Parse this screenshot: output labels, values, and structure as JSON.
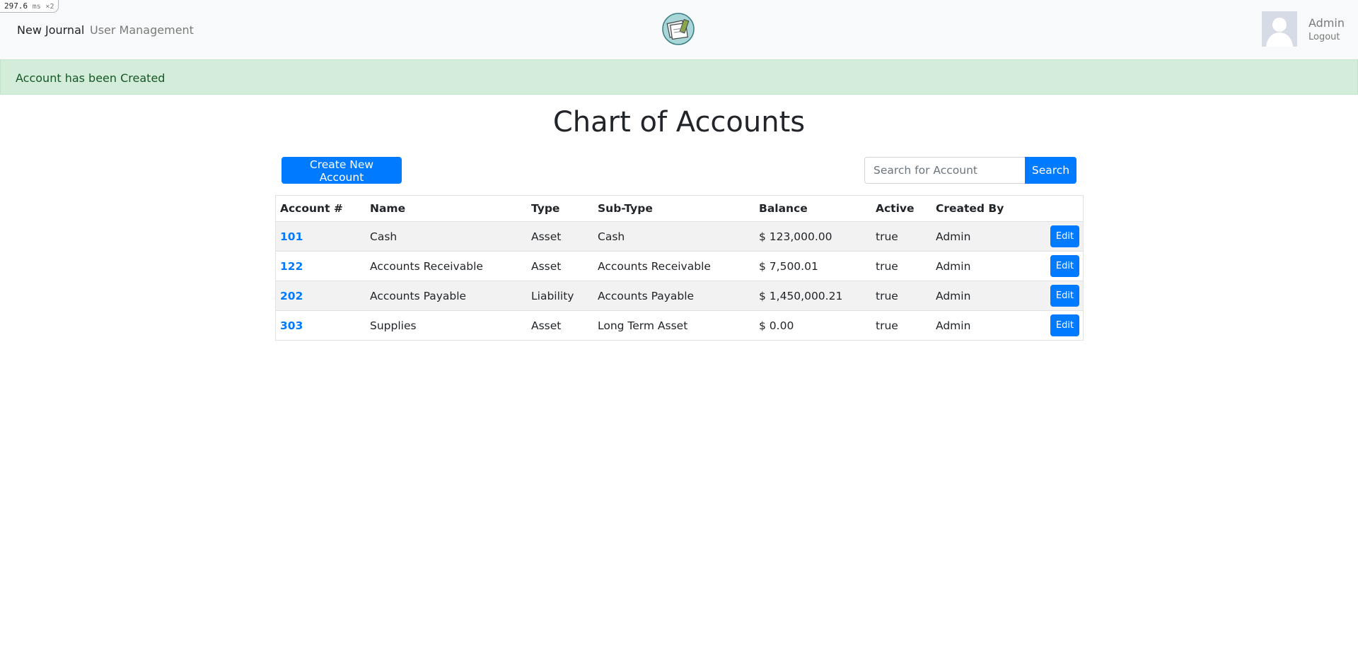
{
  "perf": {
    "value": "297.6",
    "unit": "ms",
    "mult": "×2"
  },
  "nav": {
    "links": [
      {
        "label": "New Journal"
      },
      {
        "label": "User Management"
      }
    ],
    "user": {
      "name": "Admin",
      "logout": "Logout"
    }
  },
  "alert": {
    "message": "Account has been Created"
  },
  "page": {
    "title": "Chart of Accounts"
  },
  "toolbar": {
    "create_label": "Create New Account",
    "search_placeholder": "Search for Account",
    "search_label": "Search"
  },
  "table": {
    "headers": [
      "Account #",
      "Name",
      "Type",
      "Sub-Type",
      "Balance",
      "Active",
      "Created By"
    ],
    "edit_label": "Edit",
    "rows": [
      {
        "number": "101",
        "name": "Cash",
        "type": "Asset",
        "subtype": "Cash",
        "balance": "$ 123,000.00",
        "active": "true",
        "created_by": "Admin"
      },
      {
        "number": "122",
        "name": "Accounts Receivable",
        "type": "Asset",
        "subtype": "Accounts Receivable",
        "balance": "$ 7,500.01",
        "active": "true",
        "created_by": "Admin"
      },
      {
        "number": "202",
        "name": "Accounts Payable",
        "type": "Liability",
        "subtype": "Accounts Payable",
        "balance": "$ 1,450,000.21",
        "active": "true",
        "created_by": "Admin"
      },
      {
        "number": "303",
        "name": "Supplies",
        "type": "Asset",
        "subtype": "Long Term Asset",
        "balance": "$ 0.00",
        "active": "true",
        "created_by": "Admin"
      }
    ]
  },
  "colors": {
    "primary": "#007bff",
    "alert_bg": "#d4edda",
    "alert_text": "#155724",
    "navbar_bg": "#f8f9fa"
  },
  "icons": {
    "logo": "ledger-logo-icon",
    "avatar": "user-avatar-icon"
  }
}
